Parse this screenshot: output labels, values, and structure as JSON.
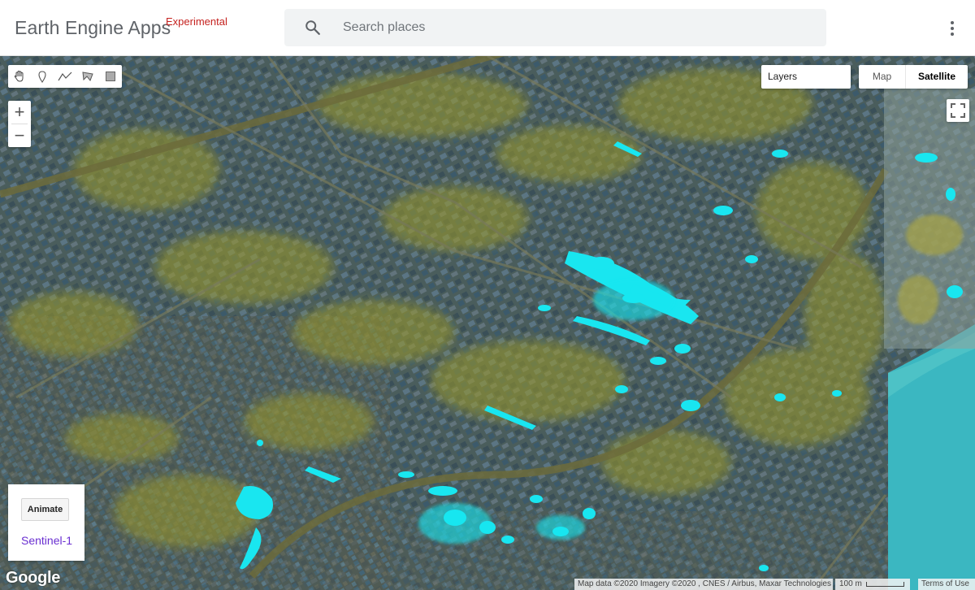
{
  "header": {
    "title": "Earth Engine Apps",
    "tag": "Experimental",
    "search": {
      "placeholder": "Search places",
      "value": ""
    },
    "more_icon": "more-vert-icon"
  },
  "map": {
    "draw_tools": [
      {
        "name": "pan-hand-icon",
        "label": "Pan"
      },
      {
        "name": "point-marker-icon",
        "label": "Add a marker"
      },
      {
        "name": "line-icon",
        "label": "Draw a line"
      },
      {
        "name": "polygon-icon",
        "label": "Draw a shape"
      },
      {
        "name": "rectangle-icon",
        "label": "Draw a rectangle"
      }
    ],
    "zoom_in": "+",
    "zoom_out": "−",
    "layers_label": "Layers",
    "map_types": [
      "Map",
      "Satellite"
    ],
    "selected_map_type": "Satellite",
    "fullscreen_icon": "fullscreen-icon"
  },
  "panel": {
    "animate_label": "Animate",
    "dataset_link": "Sentinel-1"
  },
  "footer": {
    "logo": "Google",
    "map_data": "Map data ©2020 Imagery ©2020 , CNES / Airbus, Maxar Technologies",
    "scale": "100 m",
    "terms": "Terms of Use"
  },
  "colors": {
    "flood_highlight": "#19e6f0",
    "ground_yellow": "#9c9a2a",
    "urban_blue": "#3d6577",
    "water": "#36bcc6",
    "link": "#6a2fd1",
    "tag_red": "#c5221f"
  }
}
